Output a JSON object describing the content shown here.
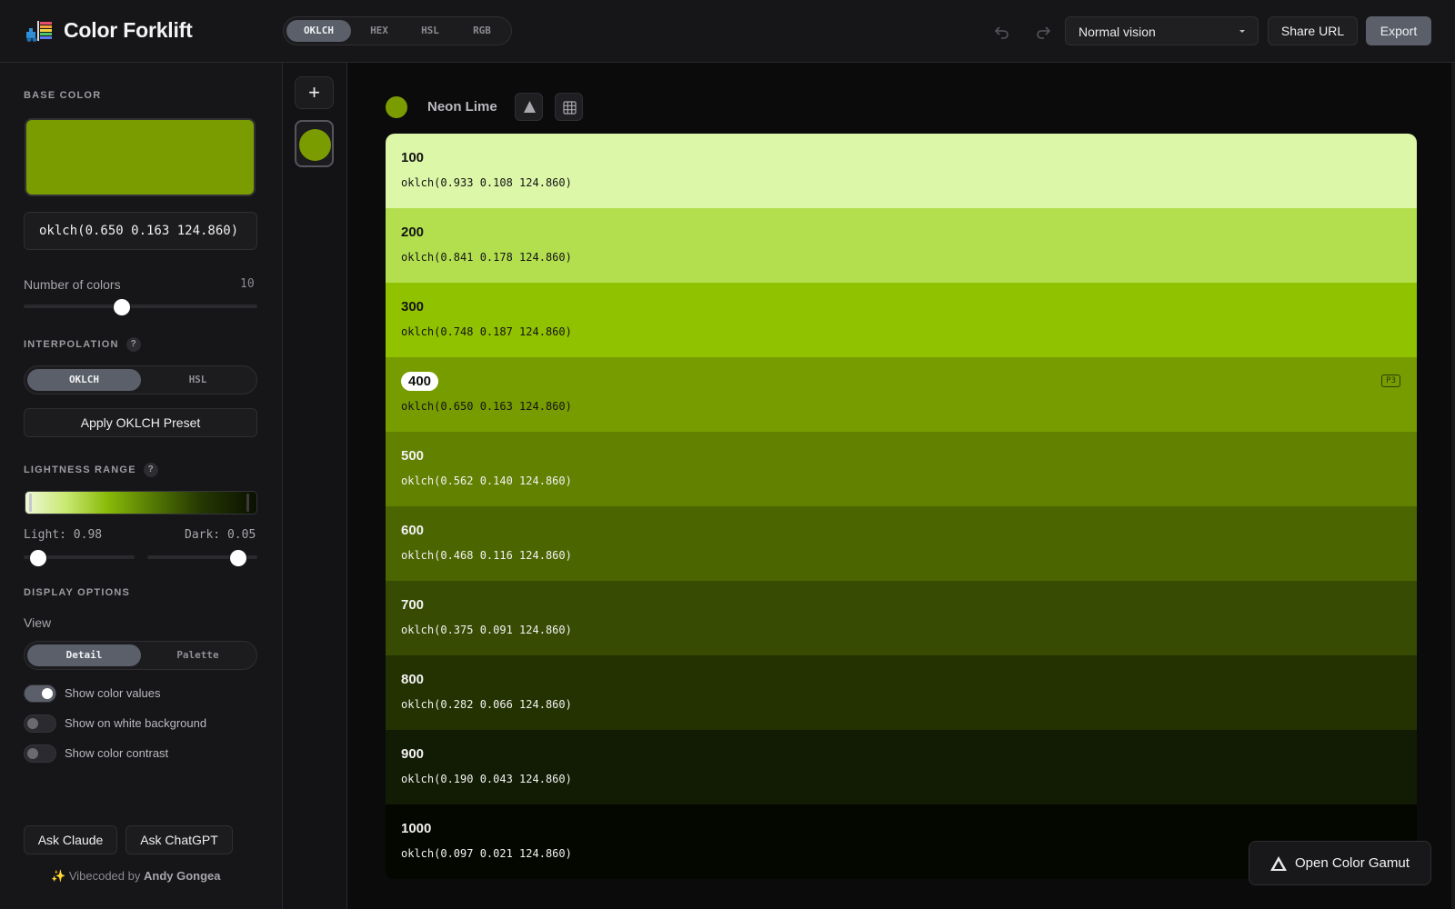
{
  "app": {
    "title": "Color Forklift"
  },
  "header": {
    "format_tabs": [
      "OKLCH",
      "HEX",
      "HSL",
      "RGB"
    ],
    "active_format": "OKLCH",
    "vision": {
      "selected": "Normal vision"
    },
    "share_label": "Share URL",
    "export_label": "Export"
  },
  "sidebar": {
    "base_color_title": "BASE COLOR",
    "base_color_hex": "#7a9c00",
    "base_color_value": "oklch(0.650 0.163 124.860)",
    "num_colors_label": "Number of colors",
    "num_colors_value": "10",
    "num_colors_fraction": 0.42,
    "interpolation_title": "INTERPOLATION",
    "interpolation_options": [
      "OKLCH",
      "HSL"
    ],
    "interpolation_active": "OKLCH",
    "preset_label": "Apply OKLCH Preset",
    "lightness_title": "LIGHTNESS RANGE",
    "light_label": "Light: 0.98",
    "dark_label": "Dark: 0.05",
    "light_value": 0.98,
    "dark_value": 0.05,
    "display_title": "DISPLAY OPTIONS",
    "view_label": "View",
    "view_options": [
      "Detail",
      "Palette"
    ],
    "view_active": "Detail",
    "toggles": [
      {
        "label": "Show color values",
        "on": true
      },
      {
        "label": "Show on white background",
        "on": false
      },
      {
        "label": "Show color contrast",
        "on": false
      }
    ],
    "help_glyph": "?",
    "ask_claude": "Ask Claude",
    "ask_chatgpt": "Ask ChatGPT",
    "credit_prefix": "Vibecoded by",
    "credit_name": "Andy Gongea",
    "credit_icon": "sparkle-icon"
  },
  "strip": {
    "add_label": "+",
    "palette_color": "#7a9c00"
  },
  "main": {
    "palette_name": "Neon Lime",
    "palette_color": "#7a9c00",
    "shades": [
      {
        "name": "100",
        "value": "oklch(0.933 0.108 124.860)",
        "color": "#dcf7a8",
        "text": "#141414"
      },
      {
        "name": "200",
        "value": "oklch(0.841 0.178 124.860)",
        "color": "#b3df4f",
        "text": "#141414"
      },
      {
        "name": "300",
        "value": "oklch(0.748 0.187 124.860)",
        "color": "#91c200",
        "text": "#141414"
      },
      {
        "name": "400",
        "value": "oklch(0.650 0.163 124.860)",
        "color": "#779c00",
        "text": "#141414",
        "selected": true,
        "badge": "P3"
      },
      {
        "name": "500",
        "value": "oklch(0.562 0.140 124.860)",
        "color": "#628100",
        "text": "#f2f2f2"
      },
      {
        "name": "600",
        "value": "oklch(0.468 0.116 124.860)",
        "color": "#4b6501",
        "text": "#f2f2f2"
      },
      {
        "name": "700",
        "value": "oklch(0.375 0.091 124.860)",
        "color": "#374b03",
        "text": "#f2f2f2"
      },
      {
        "name": "800",
        "value": "oklch(0.282 0.066 124.860)",
        "color": "#243202",
        "text": "#f2f2f2"
      },
      {
        "name": "900",
        "value": "oklch(0.190 0.043 124.860)",
        "color": "#121b03",
        "text": "#f2f2f2"
      },
      {
        "name": "1000",
        "value": "oklch(0.097 0.021 124.860)",
        "color": "#040600",
        "text": "#f2f2f2"
      }
    ],
    "gamut_button": "Open Color Gamut"
  }
}
